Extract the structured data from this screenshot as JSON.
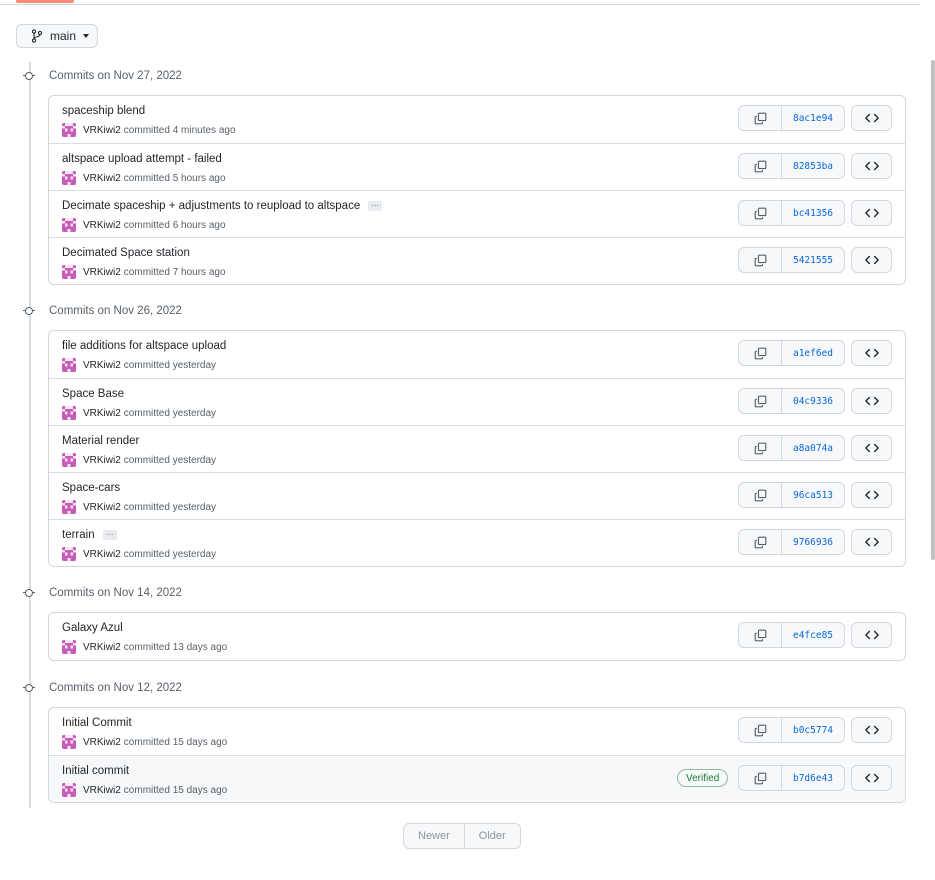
{
  "branch": {
    "name": "main"
  },
  "groups": [
    {
      "title": "Commits on Nov 27, 2022",
      "commits": [
        {
          "message": "spaceship blend",
          "author": "VRKiwi2",
          "time": "committed 4 minutes ago",
          "sha": "8ac1e94"
        },
        {
          "message": "altspace upload attempt - failed",
          "author": "VRKiwi2",
          "time": "committed 5 hours ago",
          "sha": "82853ba"
        },
        {
          "message": "Decimate spaceship + adjustments to reupload to altspace",
          "author": "VRKiwi2",
          "time": "committed 6 hours ago",
          "sha": "bc41356"
        },
        {
          "message": "Decimated Space station",
          "author": "VRKiwi2",
          "time": "committed 7 hours ago",
          "sha": "5421555"
        }
      ]
    },
    {
      "title": "Commits on Nov 26, 2022",
      "commits": [
        {
          "message": "file additions for altspace upload",
          "author": "VRKiwi2",
          "time": "committed yesterday",
          "sha": "a1ef6ed"
        },
        {
          "message": "Space Base",
          "author": "VRKiwi2",
          "time": "committed yesterday",
          "sha": "04c9336"
        },
        {
          "message": "Material render",
          "author": "VRKiwi2",
          "time": "committed yesterday",
          "sha": "a8a074a"
        },
        {
          "message": "Space-cars",
          "author": "VRKiwi2",
          "time": "committed yesterday",
          "sha": "96ca513"
        },
        {
          "message": "terrain",
          "author": "VRKiwi2",
          "time": "committed yesterday",
          "sha": "9766936"
        }
      ]
    },
    {
      "title": "Commits on Nov 14, 2022",
      "commits": [
        {
          "message": "Galaxy Azul",
          "author": "VRKiwi2",
          "time": "committed 13 days ago",
          "sha": "e4fce85"
        }
      ]
    },
    {
      "title": "Commits on Nov 12, 2022",
      "commits": [
        {
          "message": "Initial Commit",
          "author": "VRKiwi2",
          "time": "committed 15 days ago",
          "sha": "b0c5774"
        },
        {
          "message": "Initial commit",
          "author": "VRKiwi2",
          "time": "committed 15 days ago",
          "sha": "b7d6e43",
          "verified": "Verified"
        }
      ]
    }
  ],
  "pagination": {
    "newer": "Newer",
    "older": "Older"
  }
}
